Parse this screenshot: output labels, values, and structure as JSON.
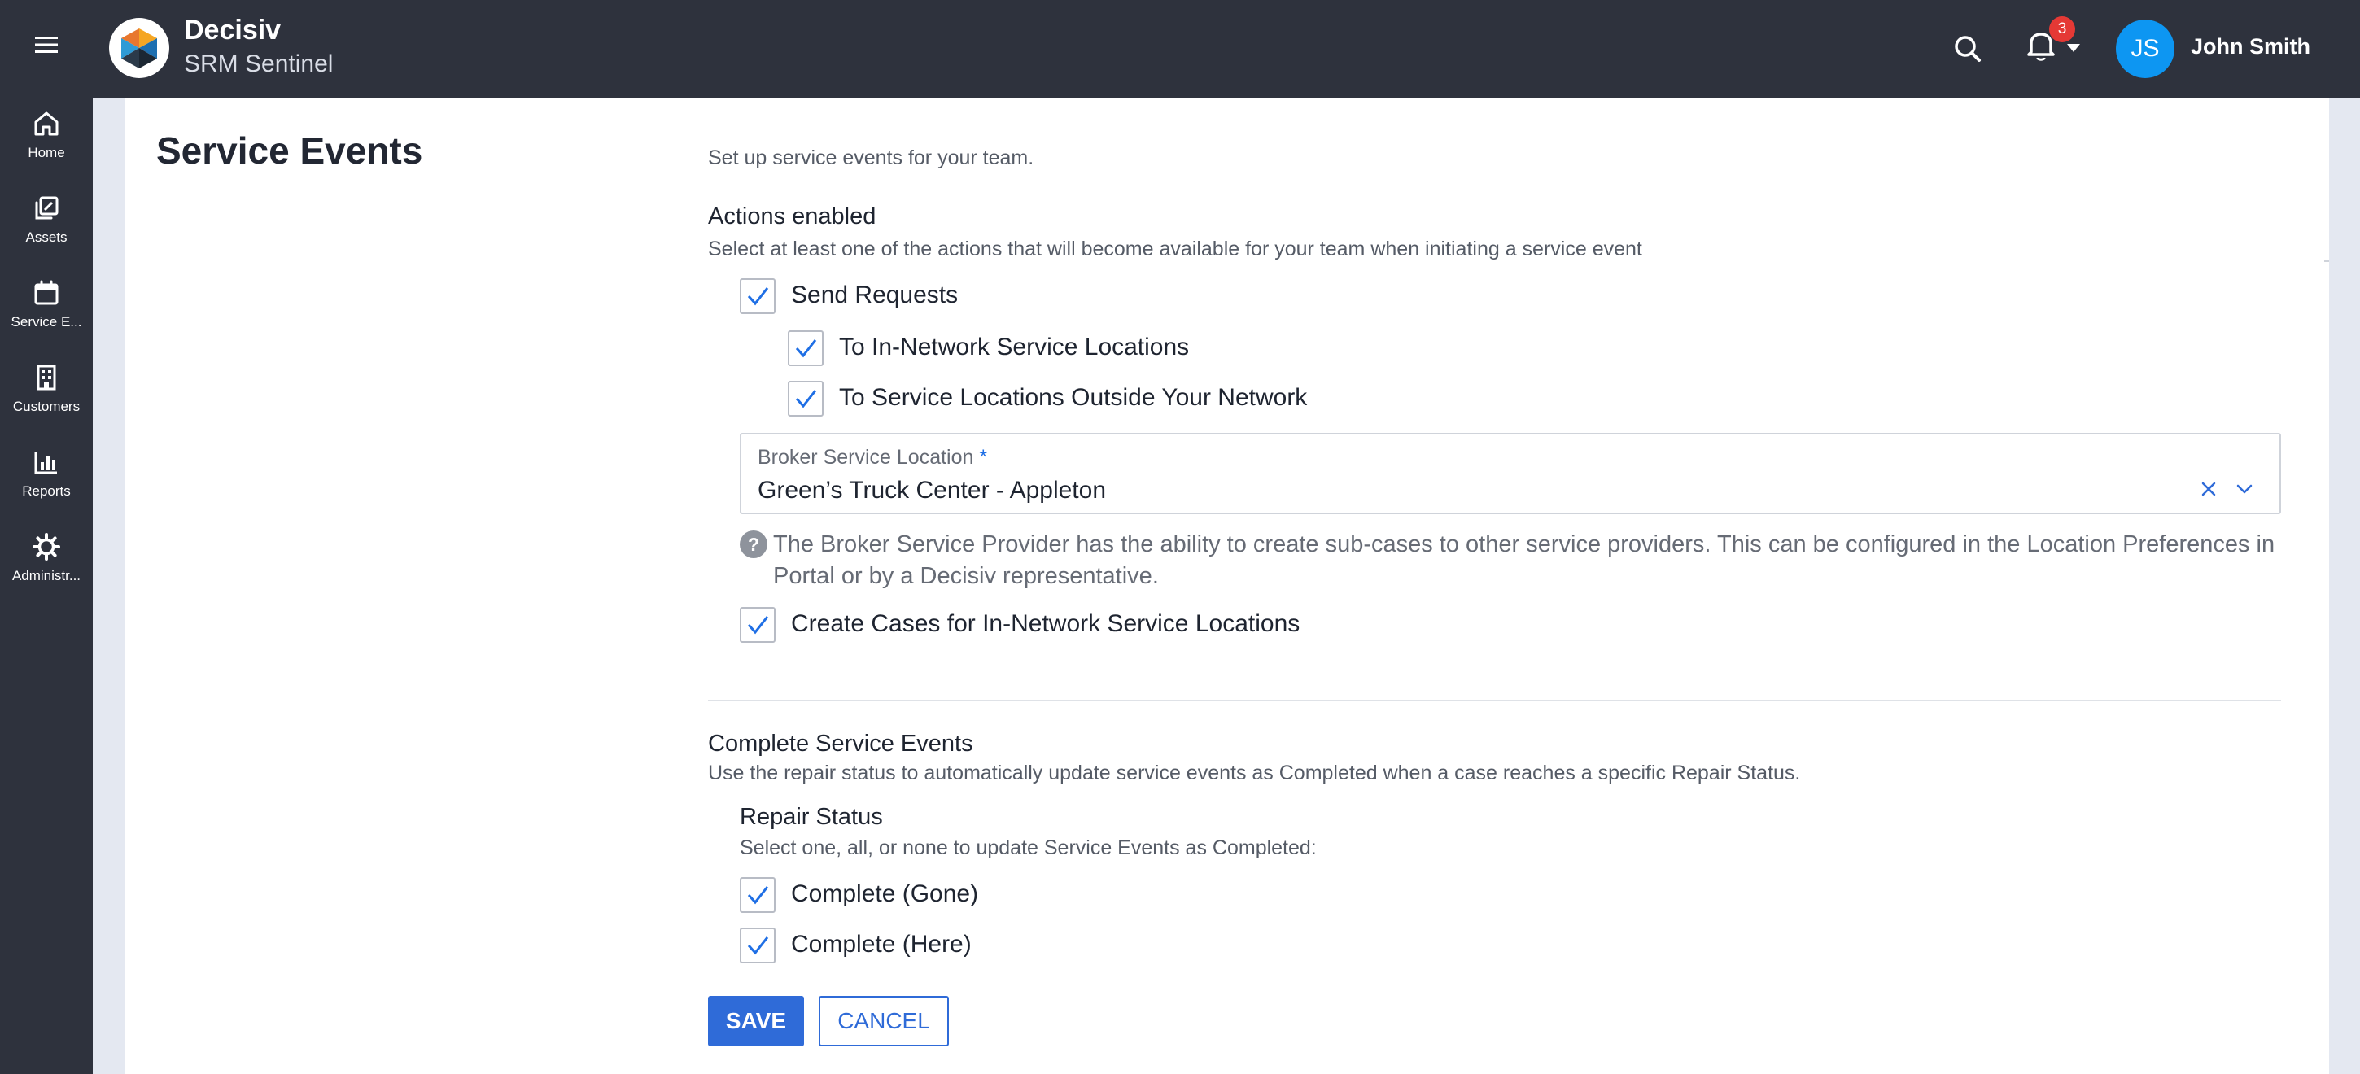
{
  "header": {
    "app_title": "Decisiv",
    "app_subtitle": "SRM Sentinel",
    "notification_count": "3",
    "user_initials": "JS",
    "user_name": "John Smith"
  },
  "sidebar": {
    "items": [
      {
        "label": "Home",
        "icon": "home-icon"
      },
      {
        "label": "Assets",
        "icon": "assets-icon"
      },
      {
        "label": "Service E...",
        "icon": "calendar-icon"
      },
      {
        "label": "Customers",
        "icon": "building-icon"
      },
      {
        "label": "Reports",
        "icon": "bar-chart-icon"
      },
      {
        "label": "Administr...",
        "icon": "gear-icon"
      }
    ]
  },
  "page": {
    "title": "Service Events",
    "intro": "Set up service events for your team."
  },
  "actions": {
    "title": "Actions enabled",
    "description": "Select at least one of the actions that will become available for your team when initiating a service event",
    "send_requests": {
      "label": "Send Requests",
      "checked": true
    },
    "in_network": {
      "label": "To In-Network Service Locations",
      "checked": true
    },
    "outside_network": {
      "label": "To Service Locations Outside Your Network",
      "checked": true
    },
    "broker": {
      "label": "Broker Service Location",
      "required_mark": "*",
      "value": "Green’s Truck Center - Appleton"
    },
    "help_text": "The Broker Service Provider has the ability to create sub-cases to other service providers. This can be configured in the Location Preferences in Portal or by a Decisiv representative.",
    "create_cases": {
      "label": "Create Cases for In-Network Service Locations",
      "checked": true
    }
  },
  "complete": {
    "title": "Complete Service Events",
    "description": "Use the repair status to automatically update service events as Completed when a case reaches a specific Repair Status.",
    "repair_title": "Repair Status",
    "repair_desc": "Select one, all, or none to update Service Events as Completed:",
    "gone": {
      "label": "Complete (Gone)",
      "checked": true
    },
    "here": {
      "label": "Complete (Here)",
      "checked": true
    }
  },
  "buttons": {
    "save": "SAVE",
    "cancel": "CANCEL"
  },
  "colors": {
    "sidebar_bg": "#2e323d",
    "accent": "#2f6bd8",
    "avatar": "#0d96f2",
    "badge": "#e53935",
    "check": "#1f6fe5"
  }
}
